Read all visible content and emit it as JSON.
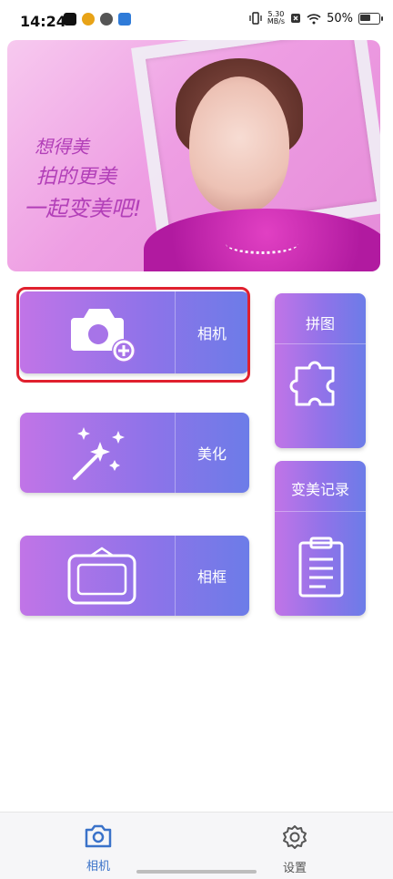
{
  "status_bar": {
    "time": "14:24",
    "net_speed_top": "5.30",
    "net_speed_bottom": "MB/s",
    "battery": "50%"
  },
  "banner": {
    "line1": "想得美",
    "line2": "拍的更美",
    "line3": "一起变美吧!"
  },
  "menu": {
    "camera": "相机",
    "beauty": "美化",
    "frame": "相框",
    "puzzle": "拼图",
    "record": "变美记录"
  },
  "nav": {
    "camera": "相机",
    "settings": "设置"
  },
  "colors": {
    "tile_start": "#c174e7",
    "tile_end": "#6c7ce8",
    "nav_active": "#3a72c9",
    "highlight": "#e0202e"
  }
}
